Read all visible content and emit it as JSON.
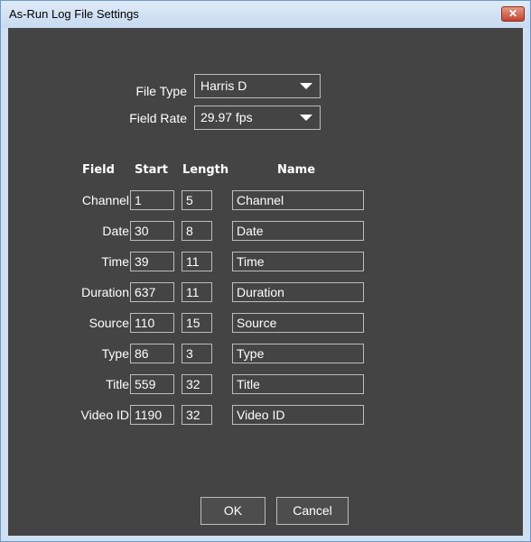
{
  "window": {
    "title": "As-Run Log File Settings"
  },
  "settings": {
    "file_type_label": "File Type",
    "file_type_value": "Harris D",
    "field_rate_label": "Field Rate",
    "field_rate_value": "29.97 fps"
  },
  "columns": {
    "field": "Field",
    "start": "Start",
    "length": "Length",
    "name": "Name"
  },
  "rows": [
    {
      "label": "Channel",
      "start": "1",
      "length": "5",
      "name": "Channel"
    },
    {
      "label": "Date",
      "start": "30",
      "length": "8",
      "name": "Date"
    },
    {
      "label": "Time",
      "start": "39",
      "length": "11",
      "name": "Time"
    },
    {
      "label": "Duration",
      "start": "637",
      "length": "11",
      "name": "Duration"
    },
    {
      "label": "Source",
      "start": "110",
      "length": "15",
      "name": "Source"
    },
    {
      "label": "Type",
      "start": "86",
      "length": "3",
      "name": "Type"
    },
    {
      "label": "Title",
      "start": "559",
      "length": "32",
      "name": "Title"
    },
    {
      "label": "Video ID",
      "start": "1190",
      "length": "32",
      "name": "Video ID"
    }
  ],
  "buttons": {
    "ok": "OK",
    "cancel": "Cancel"
  }
}
